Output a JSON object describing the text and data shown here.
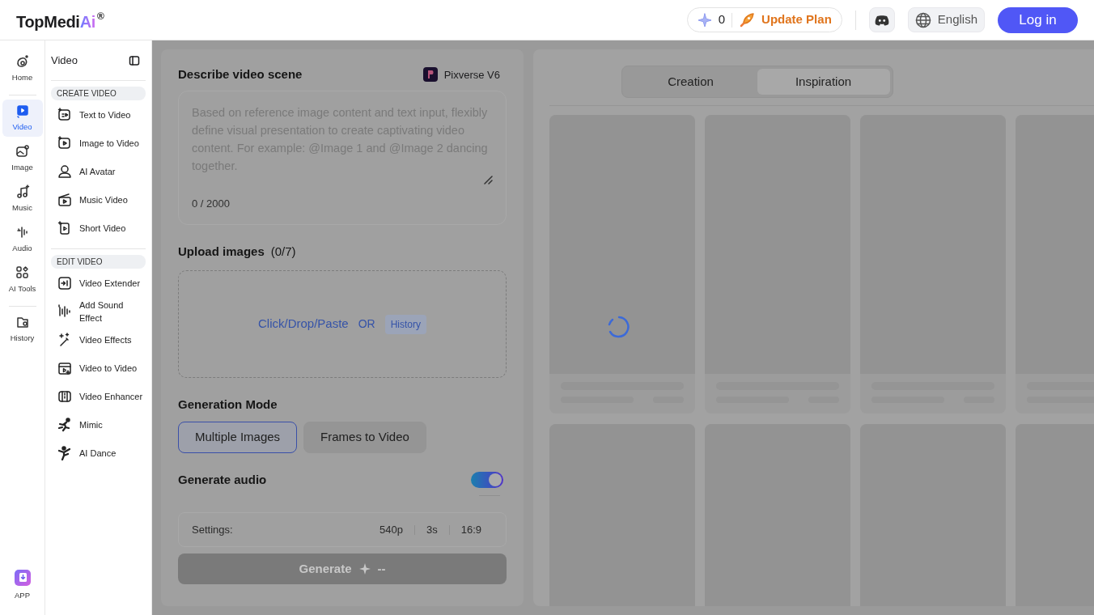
{
  "header": {
    "logo": {
      "text": "TopMedi",
      "accent": "Ai",
      "mark": "®"
    },
    "credits": "0",
    "upgrade": "Update Plan",
    "language": "English",
    "login": "Log in"
  },
  "rail": {
    "items": [
      {
        "label": "Home",
        "selected": false
      },
      {
        "label": "Video",
        "selected": true
      },
      {
        "label": "Image",
        "selected": false
      },
      {
        "label": "Music",
        "selected": false
      },
      {
        "label": "Audio",
        "selected": false
      },
      {
        "label": "AI Tools",
        "selected": false
      },
      {
        "label": "History",
        "selected": false
      }
    ],
    "app": "APP"
  },
  "sidebar": {
    "title": "Video",
    "sections": [
      {
        "heading": "CREATE VIDEO",
        "items": [
          {
            "label": "Text to Video"
          },
          {
            "label": "Image to Video"
          },
          {
            "label": "AI Avatar"
          },
          {
            "label": "Music Video"
          },
          {
            "label": "Short Video"
          }
        ]
      },
      {
        "heading": "EDIT VIDEO",
        "items": [
          {
            "label": "Video Extender"
          },
          {
            "label": "Add Sound Effect"
          },
          {
            "label": "Video Effects"
          },
          {
            "label": "Video to Video"
          },
          {
            "label": "Video Enhancer"
          },
          {
            "label": "Mimic"
          },
          {
            "label": "AI Dance"
          }
        ]
      }
    ]
  },
  "form": {
    "scene_title": "Describe video scene",
    "model": "Pixverse V6",
    "prompt": {
      "placeholder": "Based on reference image content and text input, flexibly define visual presentation to create captivating video content. For example: @Image 1 and @Image 2 dancing together.",
      "counter": "0 / 2000"
    },
    "upload": {
      "title": "Upload images",
      "count": "(0/7)",
      "action": "Click/Drop/Paste",
      "or": "OR",
      "history": "History"
    },
    "mode_title": "Generation Mode",
    "modes": [
      {
        "label": "Multiple Images",
        "selected": true
      },
      {
        "label": "Frames to Video",
        "selected": false
      }
    ],
    "audio": {
      "label": "Generate audio",
      "on": true
    },
    "settings": {
      "label": "Settings:",
      "values": [
        "540p",
        "3s",
        "16:9"
      ]
    },
    "generate": {
      "label": "Generate",
      "cost": "--",
      "disabled": true
    }
  },
  "results": {
    "tabs": [
      {
        "label": "Creation",
        "selected": false
      },
      {
        "label": "Inspiration",
        "selected": true
      }
    ],
    "loading": true
  }
}
